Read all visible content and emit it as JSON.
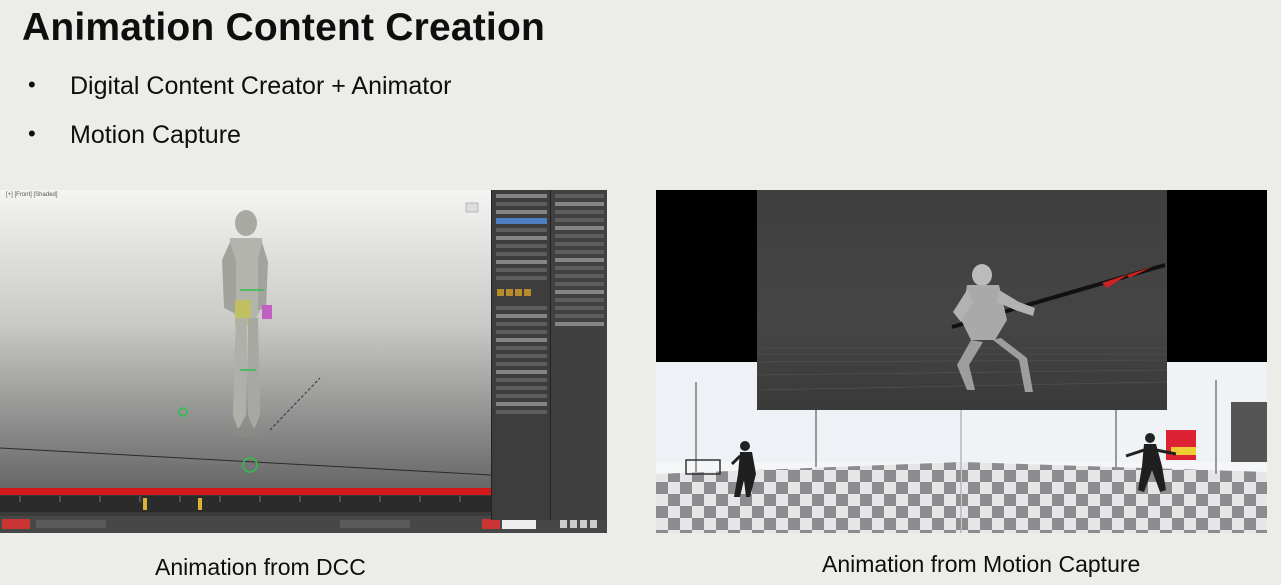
{
  "slide": {
    "title": "Animation Content Creation",
    "bullets": [
      {
        "marker": "•",
        "text": "Digital Content Creator + Animator"
      },
      {
        "marker": "•",
        "text": "Motion Capture"
      }
    ],
    "captions": {
      "left": "Animation from DCC",
      "right": "Animation from Motion Capture"
    }
  },
  "dcc_screenshot": {
    "viewport_label": "[+] [Front] [Shaded]",
    "timeline_color": "#d21a1a",
    "accent_color": "#4c7fc4",
    "icons": [
      "biped-figure",
      "timeline-ruler",
      "command-panel"
    ]
  },
  "mocap_screenshot": {
    "icons": [
      "armored-warrior-with-spear",
      "capture-studio-checkerboard-floor",
      "performer-left",
      "performer-right"
    ]
  }
}
